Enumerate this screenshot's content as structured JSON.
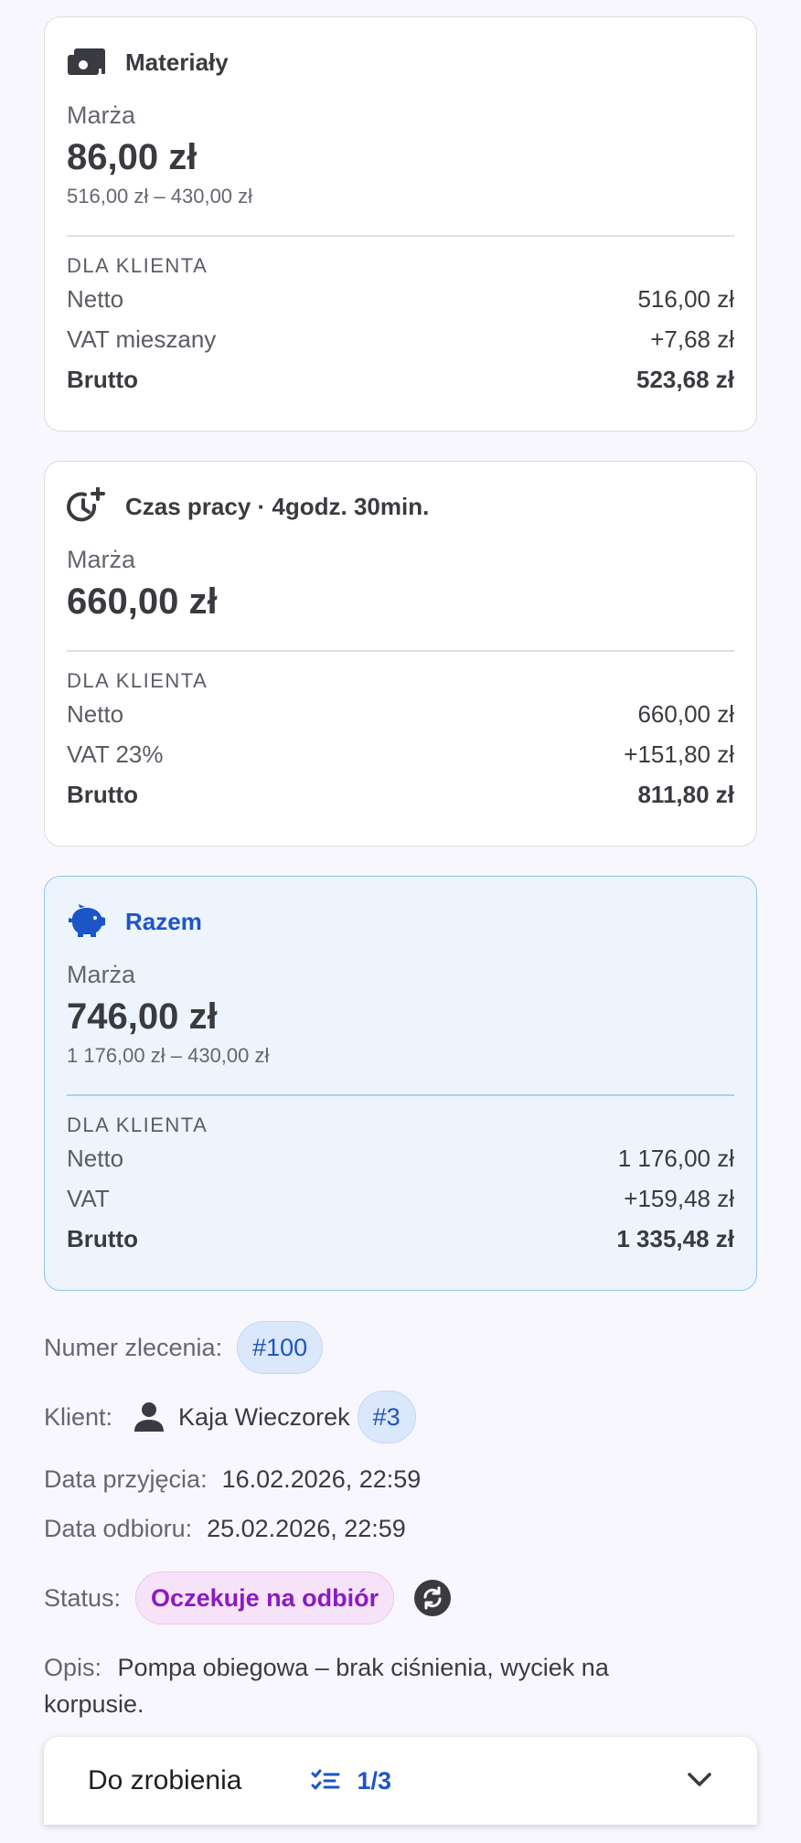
{
  "materials": {
    "icon": "banknotes-icon",
    "title": "Materiały",
    "marza_label": "Marża",
    "marza_value": "86,00 zł",
    "formula": "516,00 zł – 430,00 zł",
    "section_label": "DLA KLIENTA",
    "netto_label": "Netto",
    "netto_value": "516,00 zł",
    "vat_label": "VAT mieszany",
    "vat_value": "+7,68 zł",
    "brutto_label": "Brutto",
    "brutto_value": "523,68 zł"
  },
  "labor": {
    "icon": "clock-plus-icon",
    "title": "Czas pracy · 4godz. 30min.",
    "marza_label": "Marża",
    "marza_value": "660,00 zł",
    "section_label": "DLA KLIENTA",
    "netto_label": "Netto",
    "netto_value": "660,00 zł",
    "vat_label": "VAT 23%",
    "vat_value": "+151,80 zł",
    "brutto_label": "Brutto",
    "brutto_value": "811,80 zł"
  },
  "total": {
    "icon": "piggy-bank-icon",
    "title": "Razem",
    "marza_label": "Marża",
    "marza_value": "746,00 zł",
    "formula": "1 176,00 zł – 430,00 zł",
    "section_label": "DLA KLIENTA",
    "netto_label": "Netto",
    "netto_value": "1 176,00 zł",
    "vat_label": "VAT",
    "vat_value": "+159,48 zł",
    "brutto_label": "Brutto",
    "brutto_value": "1 335,48 zł"
  },
  "order": {
    "number_label": "Numer zlecenia:",
    "number_value": "#100",
    "client_label": "Klient:",
    "client_name": "Kaja Wieczorek",
    "client_id": "#3",
    "accepted_label": "Data przyjęcia:",
    "accepted_value": "16.02.2026, 22:59",
    "pickup_label": "Data odbioru:",
    "pickup_value": "25.02.2026, 22:59",
    "status_label": "Status:",
    "status_value": "Oczekuje na odbiór",
    "description_label": "Opis:",
    "description_value": "Pompa obiegowa – brak ciśnienia, wyciek na korpusie."
  },
  "todo": {
    "title": "Do zrobienia",
    "progress": "1/3"
  },
  "colors": {
    "accent": "#1c55c6",
    "status": "#8b19c4",
    "total_bg": "#edf4fe"
  }
}
